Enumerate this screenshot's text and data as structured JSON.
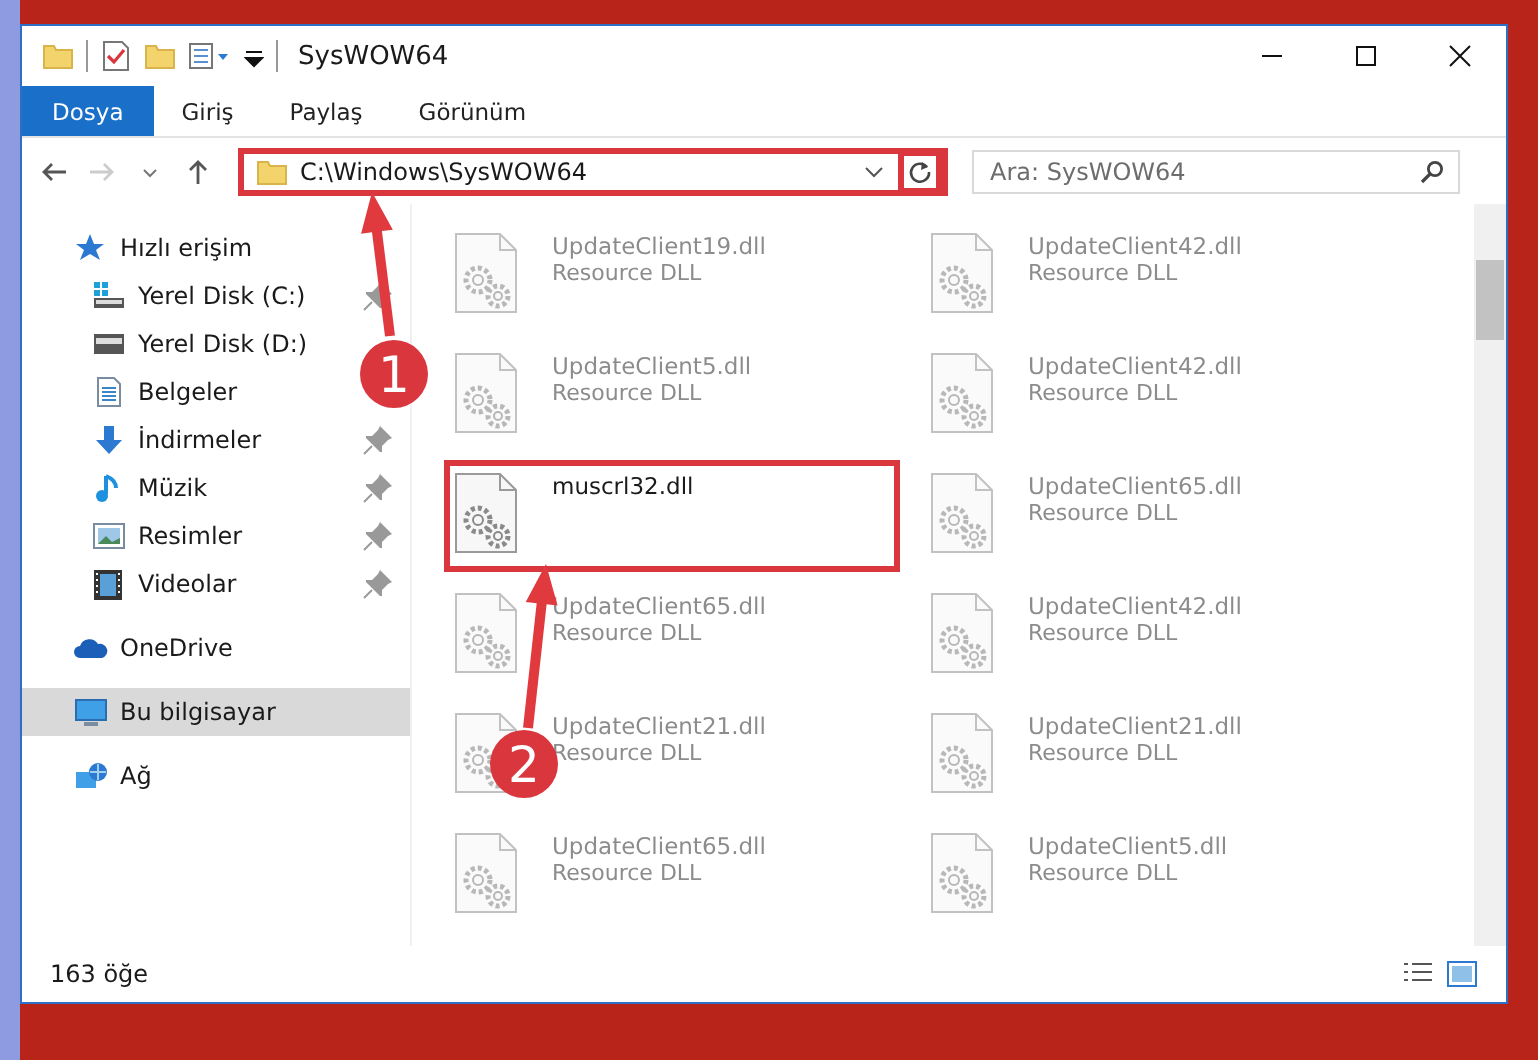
{
  "window": {
    "title": "SysWOW64"
  },
  "ribbon_tabs": [
    {
      "label": "Dosya",
      "selected": true
    },
    {
      "label": "Giriş",
      "selected": false
    },
    {
      "label": "Paylaş",
      "selected": false
    },
    {
      "label": "Görünüm",
      "selected": false
    }
  ],
  "address_bar": {
    "path": "C:\\Windows\\SysWOW64",
    "highlighted": true
  },
  "refresh_button": {
    "highlighted": true
  },
  "search": {
    "placeholder": "Ara: SysWOW64"
  },
  "nav_pane": {
    "items": [
      {
        "label": "Hızlı erişim",
        "kind": "star",
        "selected": false,
        "children": [
          {
            "label": "Yerel Disk (C:)",
            "kind": "drive-c",
            "selected": false,
            "pinned": true
          },
          {
            "label": "Yerel Disk (D:)",
            "kind": "drive",
            "selected": false,
            "pinned": false
          },
          {
            "label": "Belgeler",
            "kind": "document",
            "selected": false,
            "pinned": false
          },
          {
            "label": "İndirmeler",
            "kind": "download",
            "selected": false,
            "pinned": true
          },
          {
            "label": "Müzik",
            "kind": "music",
            "selected": false,
            "pinned": true
          },
          {
            "label": "Resimler",
            "kind": "picture",
            "selected": false,
            "pinned": true
          },
          {
            "label": "Videolar",
            "kind": "video",
            "selected": false,
            "pinned": true
          }
        ]
      },
      {
        "label": "OneDrive",
        "kind": "cloud",
        "selected": false
      },
      {
        "label": "Bu bilgisayar",
        "kind": "pc",
        "selected": true
      },
      {
        "label": "Ağ",
        "kind": "network",
        "selected": false
      }
    ]
  },
  "files": [
    {
      "name": "UpdateClient19.dll",
      "type": "Resource DLL",
      "blurred": true,
      "highlighted": false
    },
    {
      "name": "UpdateClient42.dll",
      "type": "Resource DLL",
      "blurred": true,
      "highlighted": false
    },
    {
      "name": "UpdateClient5.dll",
      "type": "Resource DLL",
      "blurred": true,
      "highlighted": false
    },
    {
      "name": "UpdateClient42.dll",
      "type": "Resource DLL",
      "blurred": true,
      "highlighted": false
    },
    {
      "name": "muscrl32.dll",
      "blurred": false,
      "highlighted": true
    },
    {
      "name": "UpdateClient65.dll",
      "type": "Resource DLL",
      "blurred": true,
      "highlighted": false
    },
    {
      "name": "UpdateClient65.dll",
      "type": "Resource DLL",
      "blurred": true,
      "highlighted": false
    },
    {
      "name": "UpdateClient42.dll",
      "type": "Resource DLL",
      "blurred": true,
      "highlighted": false
    },
    {
      "name": "UpdateClient21.dll",
      "type": "Resource DLL",
      "blurred": true,
      "highlighted": false
    },
    {
      "name": "UpdateClient21.dll",
      "type": "Resource DLL",
      "blurred": true,
      "highlighted": false
    },
    {
      "name": "UpdateClient65.dll",
      "type": "Resource DLL",
      "blurred": true,
      "highlighted": false
    },
    {
      "name": "UpdateClient5.dll",
      "type": "Resource DLL",
      "blurred": true,
      "highlighted": false
    }
  ],
  "annotations": [
    {
      "number": "1"
    },
    {
      "number": "2"
    }
  ],
  "status_bar": {
    "item_count": "163 öğe"
  }
}
